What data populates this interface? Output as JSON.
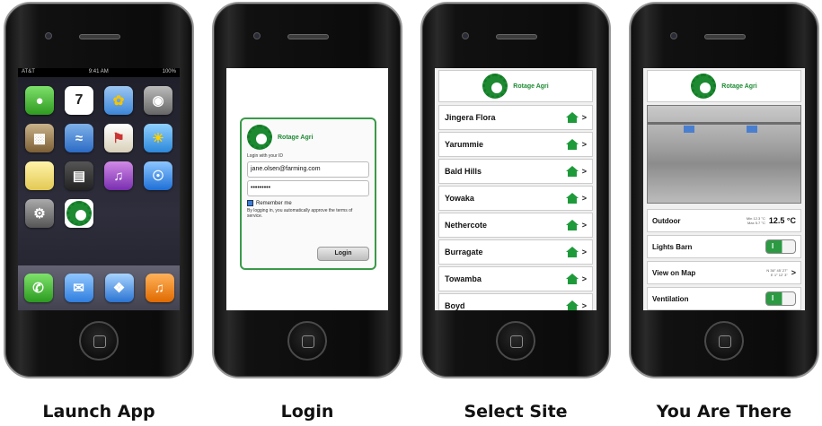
{
  "captions": [
    "Launch App",
    "Login",
    "Select Site",
    "You Are There"
  ],
  "brand": "Rotage Agri",
  "home_screen": {
    "status": {
      "carrier": "AT&T",
      "time": "9:41 AM",
      "battery": "100%"
    },
    "calendar_day": "7",
    "icons": [
      "messages-icon",
      "calendar-icon",
      "photos-icon",
      "camera-icon",
      "youtube-icon",
      "stocks-icon",
      "maps-icon",
      "weather-icon",
      "notes-icon",
      "clock-icon",
      "itunes-icon",
      "appstore-icon",
      "settings-icon",
      "rotage-agri-app-icon"
    ],
    "dock": [
      "phone-icon",
      "mail-icon",
      "safari-icon",
      "ipod-icon"
    ]
  },
  "login": {
    "prompt": "Login with your ID",
    "username": "jane.olsen@farming.com",
    "password": "•••••••••",
    "remember_label": "Remember me",
    "disclaimer": "By logging in, you automatically approve the terms of service.",
    "button": "Login"
  },
  "sites": [
    "Jingera Flora",
    "Yarummie",
    "Bald Hills",
    "Yowaka",
    "Nethercote",
    "Burragate",
    "Towamba",
    "Boyd"
  ],
  "dashboard": {
    "outdoor_label": "Outdoor",
    "outdoor_minmax": "Min 12.3 °C\nMax 5.7 °C",
    "outdoor_temp": "12.5 °C",
    "lights_label": "Lights Barn",
    "lights_toggle": "I",
    "map_label": "View on Map",
    "map_coords": "N 36° 45' 27\"\nE 1° 12' 3\"",
    "ventilation_label": "Ventilation",
    "ventilation_toggle": "I"
  }
}
